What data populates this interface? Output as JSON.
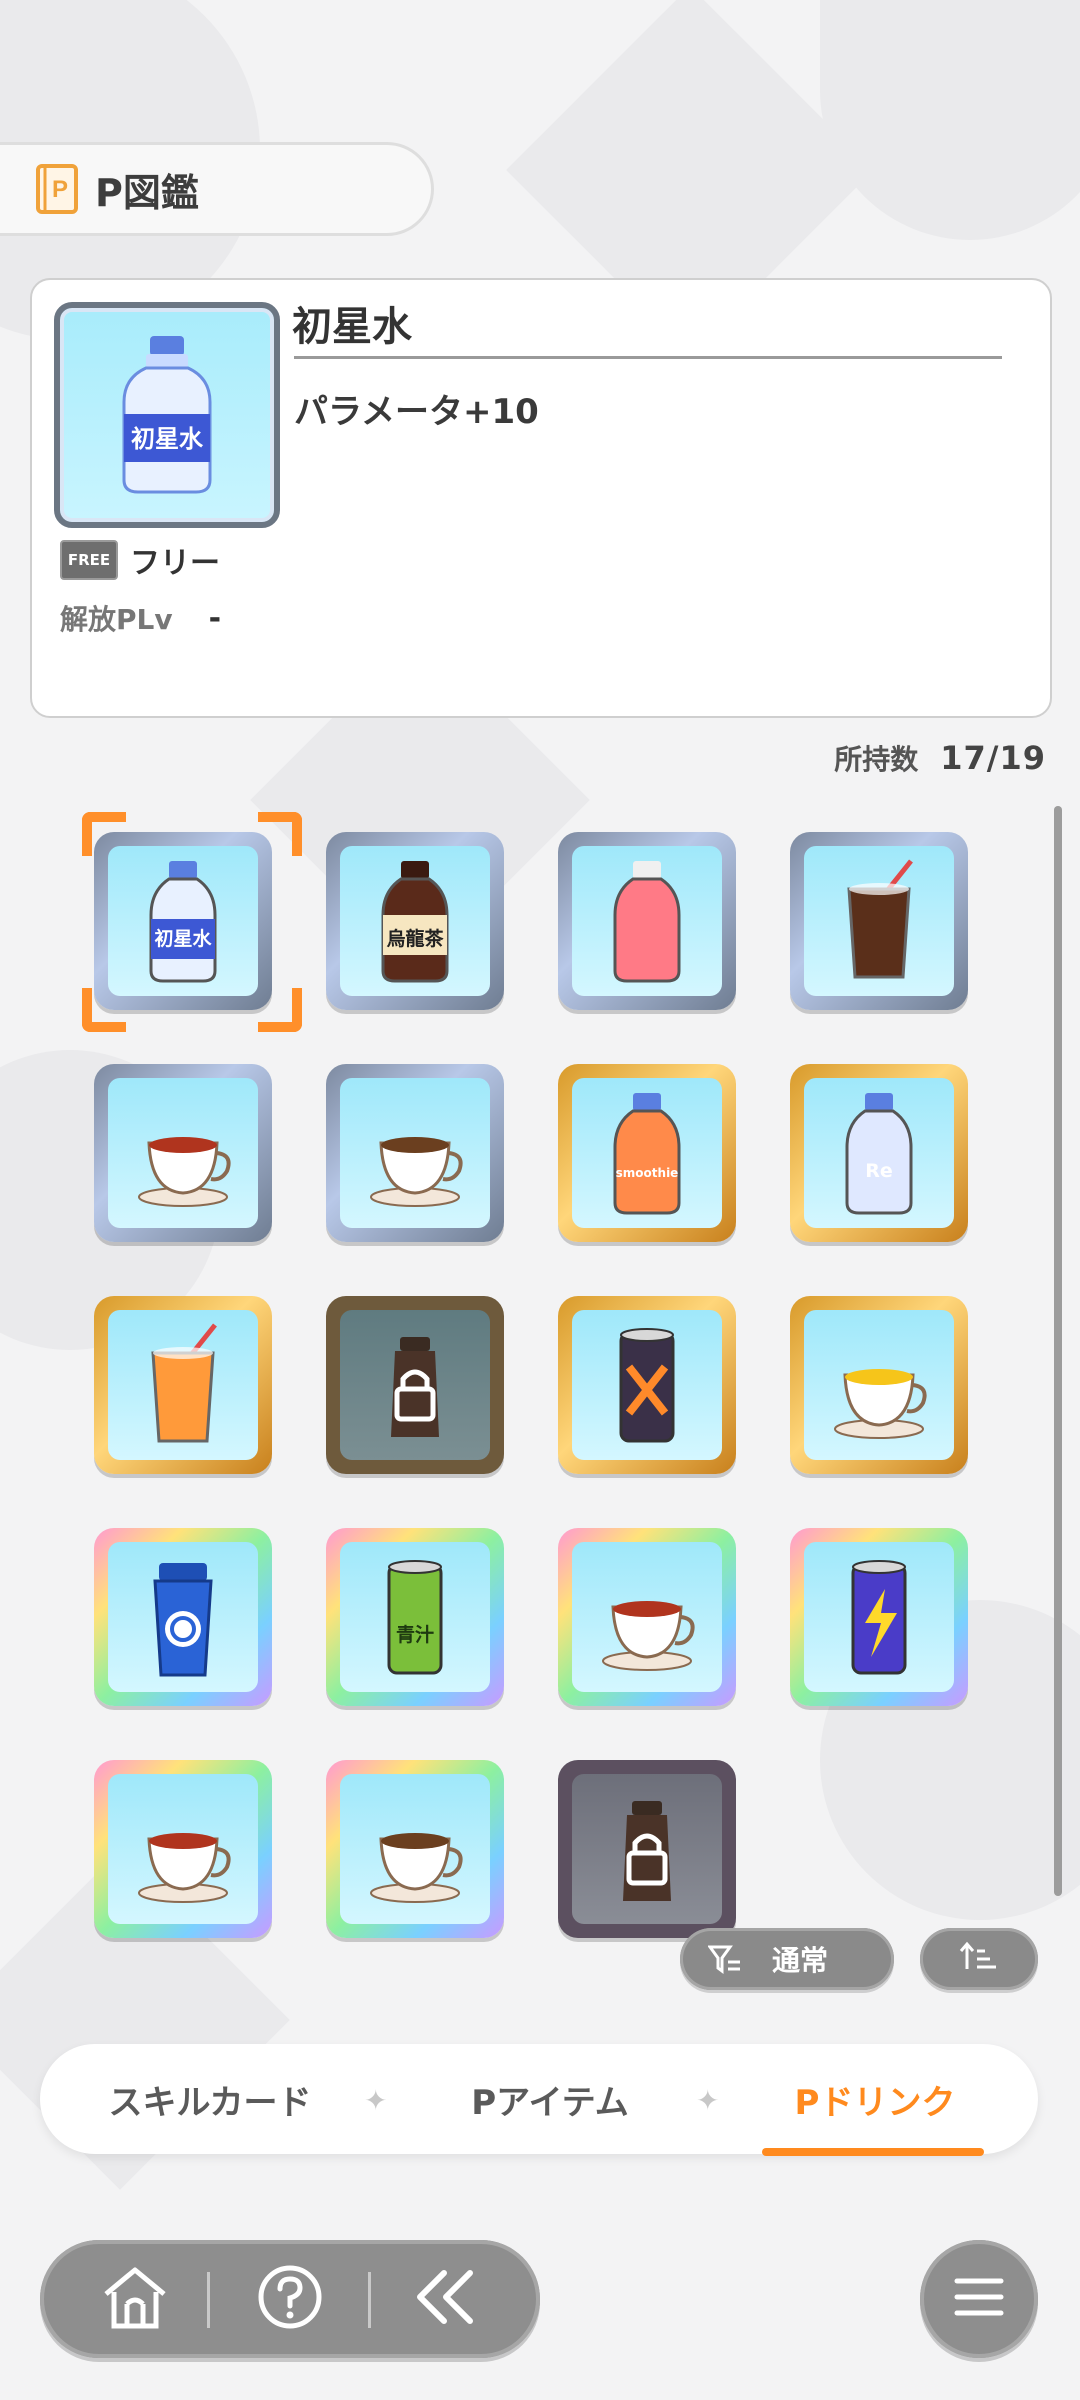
{
  "header": {
    "title": "P図鑑",
    "book_icon": "p-book-icon"
  },
  "selected": {
    "name": "初星水",
    "effect": "パラメータ+10",
    "plan_badge": "FREE",
    "plan_label": "フリー",
    "unlock_label": "解放PLv",
    "unlock_value": "-"
  },
  "owned": {
    "label": "所持数",
    "value": "17/19"
  },
  "drinks": [
    {
      "id": "hatsuboshi-water",
      "rarity": "common",
      "locked": false,
      "icon": "water-bottle-icon",
      "text": "初星水",
      "selected": true
    },
    {
      "id": "oolong-tea",
      "rarity": "common",
      "locked": false,
      "icon": "oolong-tea-bottle-icon",
      "text": "烏龍茶"
    },
    {
      "id": "pink-soda",
      "rarity": "common",
      "locked": false,
      "icon": "pink-soda-bottle-icon",
      "text": ""
    },
    {
      "id": "iced-coffee",
      "rarity": "common",
      "locked": false,
      "icon": "iced-coffee-icon",
      "text": ""
    },
    {
      "id": "red-tea",
      "rarity": "common",
      "locked": false,
      "icon": "tea-cup-icon",
      "text": ""
    },
    {
      "id": "hot-coffee",
      "rarity": "common",
      "locked": false,
      "icon": "coffee-cup-icon",
      "text": ""
    },
    {
      "id": "strawberry-smoothie",
      "rarity": "gold",
      "locked": false,
      "icon": "smoothie-bottle-icon",
      "text": "smoothie"
    },
    {
      "id": "sports-drink",
      "rarity": "gold",
      "locked": false,
      "icon": "sports-bottle-icon",
      "text": "Re"
    },
    {
      "id": "fruit-soda",
      "rarity": "gold",
      "locked": false,
      "icon": "fruit-drink-icon",
      "text": ""
    },
    {
      "id": "locked-bottle-1",
      "rarity": "locked",
      "locked": true,
      "icon": "lock-icon",
      "text": ""
    },
    {
      "id": "energy-can",
      "rarity": "gold",
      "locked": false,
      "icon": "energy-can-icon",
      "text": ""
    },
    {
      "id": "herb-tea",
      "rarity": "gold",
      "locked": false,
      "icon": "herb-tea-icon",
      "text": ""
    },
    {
      "id": "protein-shaker",
      "rarity": "rainbow",
      "locked": false,
      "icon": "shaker-icon",
      "text": ""
    },
    {
      "id": "aojiru-can",
      "rarity": "rainbow",
      "locked": false,
      "icon": "aojiru-can-icon",
      "text": "青汁"
    },
    {
      "id": "special-cup",
      "rarity": "rainbow",
      "locked": false,
      "icon": "special-cup-icon",
      "text": ""
    },
    {
      "id": "thunder-can",
      "rarity": "rainbow",
      "locked": false,
      "icon": "thunder-can-icon",
      "text": ""
    },
    {
      "id": "royal-tea",
      "rarity": "rainbow",
      "locked": false,
      "icon": "royal-tea-icon",
      "text": ""
    },
    {
      "id": "cafe-latte",
      "rarity": "rainbow",
      "locked": false,
      "icon": "latte-cup-icon",
      "text": ""
    },
    {
      "id": "locked-bottle-2",
      "rarity": "locked2",
      "locked": true,
      "icon": "lock-icon",
      "text": ""
    }
  ],
  "controls": {
    "filter_label": "通常",
    "filter_icon": "filter-icon",
    "sort_icon": "sort-ascending-icon"
  },
  "tabs": [
    {
      "label": "スキルカード",
      "active": false
    },
    {
      "label": "Pアイテム",
      "active": false
    },
    {
      "label": "Pドリンク",
      "active": true
    }
  ],
  "nav": {
    "home_icon": "home-icon",
    "help_icon": "help-icon",
    "back_icon": "back-chevrons-icon",
    "menu_icon": "hamburger-menu-icon"
  },
  "colors": {
    "accent": "#ff8a1e",
    "button_gray": "#8e8e8e",
    "tile_bg": "#a8ecfb",
    "gold_frame": "#f0b445"
  }
}
